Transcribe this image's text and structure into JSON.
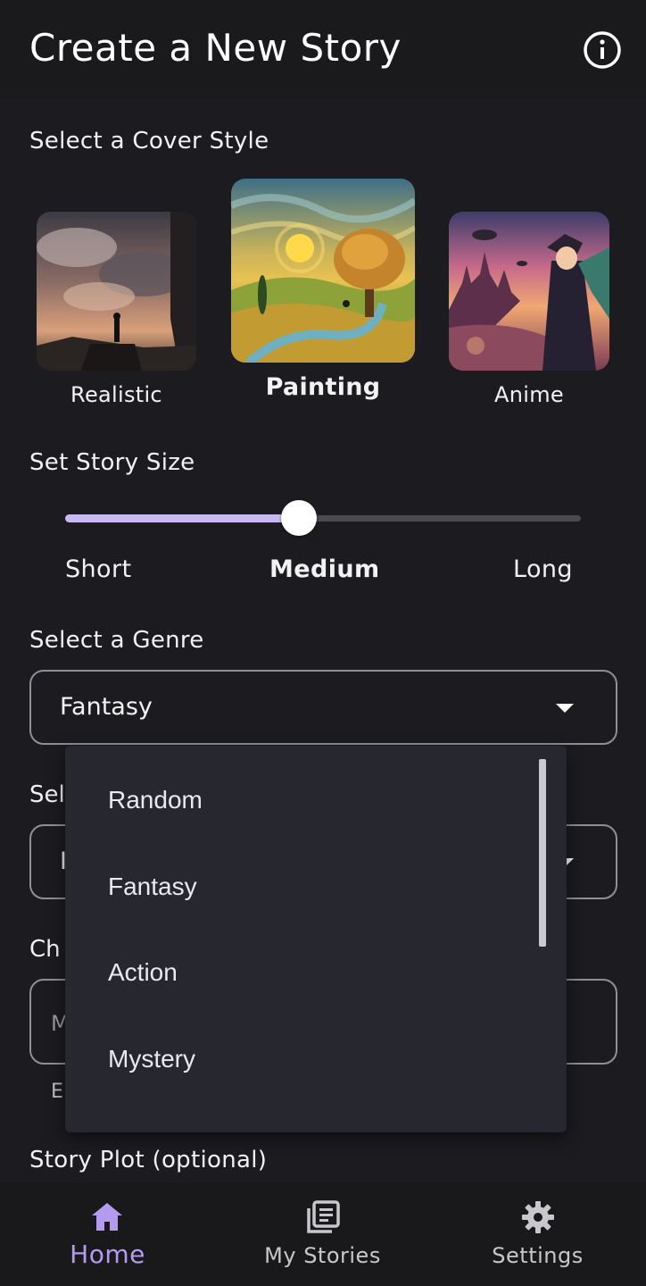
{
  "app_bar": {
    "title": "Create a New Story",
    "info_icon": "info-icon"
  },
  "cover_style": {
    "label": "Select a Cover Style",
    "options": [
      {
        "label": "Realistic",
        "selected": false
      },
      {
        "label": "Painting",
        "selected": true
      },
      {
        "label": "Anime",
        "selected": false
      }
    ]
  },
  "story_size": {
    "label": "Set Story Size",
    "options": [
      "Short",
      "Medium",
      "Long"
    ],
    "selected": "Medium",
    "value_fraction": 0.5
  },
  "genre": {
    "label": "Select a Genre",
    "value": "Fantasy",
    "menu_items": [
      "Random",
      "Fantasy",
      "Action",
      "Mystery"
    ]
  },
  "obscured": {
    "field2_label_partial": "Sel",
    "field2_value_partial": "I",
    "field3_label_partial": "Ch",
    "field3_value_partial": "M",
    "field3_helper_partial": "E"
  },
  "story_plot": {
    "label": "Story Plot (optional)"
  },
  "bottom_nav": {
    "items": [
      {
        "label": "Home",
        "icon": "home-icon",
        "active": true
      },
      {
        "label": "My Stories",
        "icon": "library-icon",
        "active": false
      },
      {
        "label": "Settings",
        "icon": "gear-icon",
        "active": false
      }
    ]
  },
  "colors": {
    "background": "#1c1b20",
    "accent": "#b49bf0",
    "slider_fill": "#c9b9f3",
    "menu_background": "#27272f"
  }
}
